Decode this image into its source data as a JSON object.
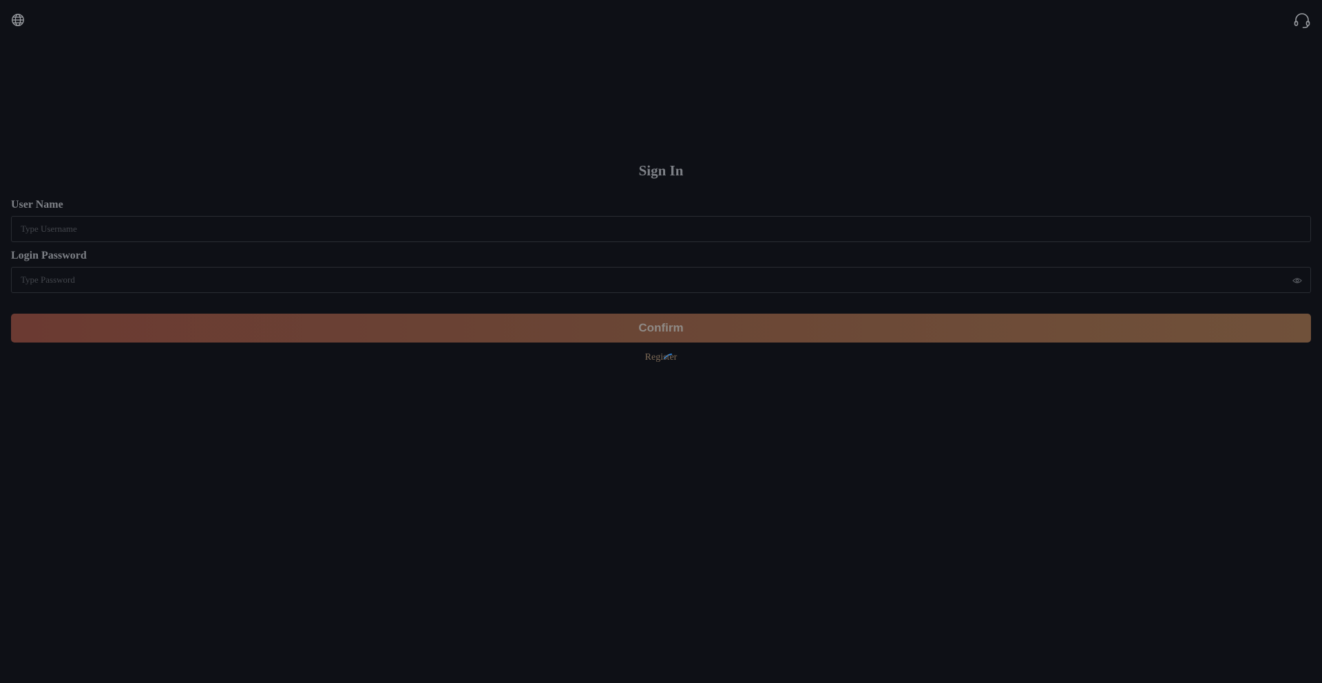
{
  "header": {
    "language_icon": "globe-icon",
    "support_icon": "headset-icon"
  },
  "form": {
    "title": "Sign In",
    "username": {
      "label": "User Name",
      "value": "",
      "placeholder": "Type Username"
    },
    "password": {
      "label": "Login Password",
      "value": "",
      "placeholder": "Type Password",
      "toggle_icon": "eye-icon"
    },
    "confirm_label": "Confirm",
    "register_label": "Register"
  },
  "colors": {
    "background": "#0e1016",
    "button_gradient_start": "#6b3a32",
    "button_gradient_end": "#70513a",
    "link": "#7d6a56",
    "spinner": "#2a7fd4"
  }
}
